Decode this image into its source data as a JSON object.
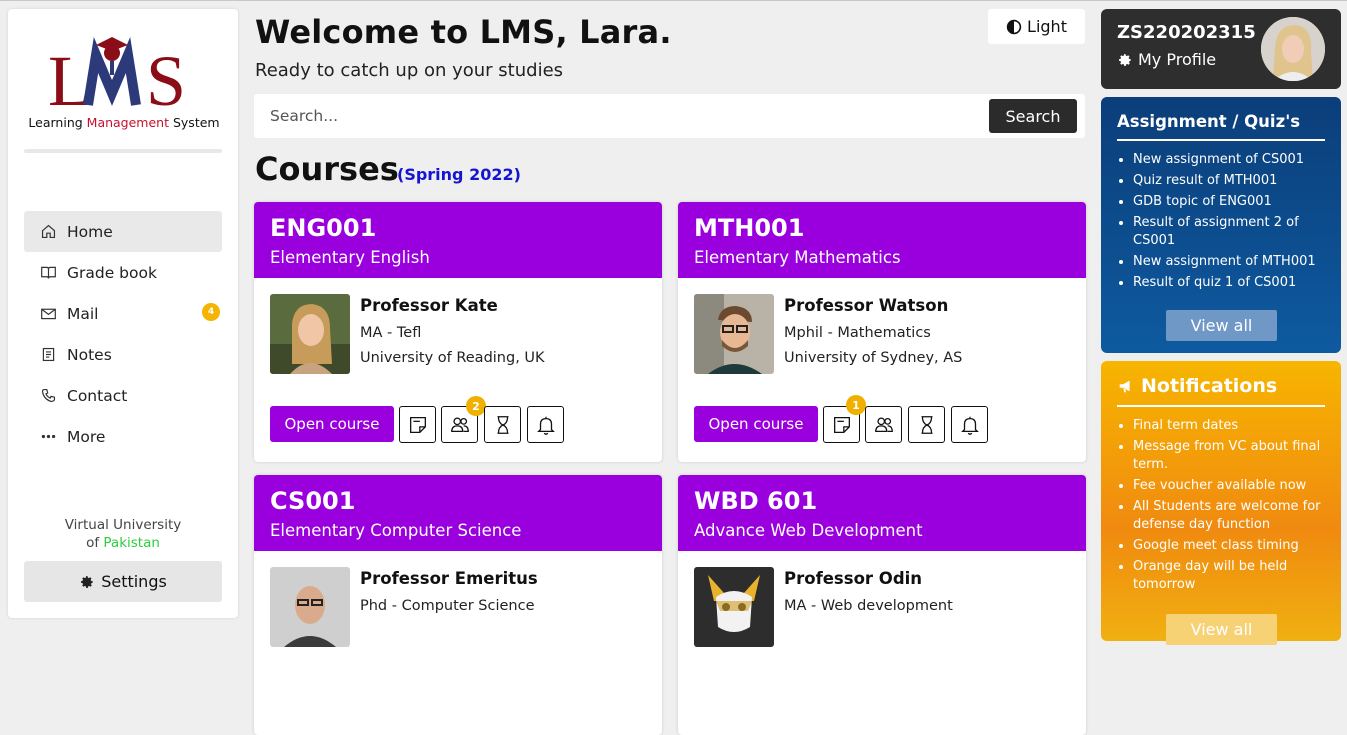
{
  "sidebar": {
    "logo_text_before": "Learning ",
    "logo_text_red": "Management",
    "logo_text_after": " System",
    "nav": [
      {
        "label": "Home",
        "icon": "home-icon"
      },
      {
        "label": "Grade book",
        "icon": "book-icon"
      },
      {
        "label": "Mail",
        "icon": "mail-icon",
        "badge": "4"
      },
      {
        "label": "Notes",
        "icon": "notes-icon"
      },
      {
        "label": "Contact",
        "icon": "phone-icon"
      },
      {
        "label": "More",
        "icon": "more-icon"
      }
    ],
    "university_line1": "Virtual University",
    "university_of": "of ",
    "university_country": "Pakistan",
    "settings_label": "Settings"
  },
  "header": {
    "welcome": "Welcome to LMS, Lara.",
    "subtitle": "Ready to catch up on your studies",
    "theme_label": "Light"
  },
  "search": {
    "placeholder": "Search...",
    "button_label": "Search"
  },
  "courses": {
    "title": "Courses",
    "semester": "(Spring 2022)",
    "open_label": "Open course",
    "items": [
      {
        "code": "ENG001",
        "name": "Elementary English",
        "professor": "Professor Kate",
        "degree": "MA - Tefl",
        "university": "University of Reading, UK",
        "group_badge": "2"
      },
      {
        "code": "MTH001",
        "name": "Elementary Mathematics",
        "professor": "Professor Watson",
        "degree": "Mphil - Mathematics",
        "university": "University of Sydney, AS",
        "notes_badge": "1"
      },
      {
        "code": "CS001",
        "name": "Elementary Computer Science",
        "professor": "Professor Emeritus",
        "degree": "Phd - Computer Science",
        "university": ""
      },
      {
        "code": "WBD 601",
        "name": "Advance Web Development",
        "professor": "Professor Odin",
        "degree": "MA - Web development",
        "university": ""
      }
    ]
  },
  "profile": {
    "id": "ZS220202315",
    "link_label": "My Profile"
  },
  "assignments": {
    "title": "Assignment / Quiz's",
    "items": [
      "New assignment of CS001",
      "Quiz result of MTH001",
      "GDB topic of ENG001",
      "Result of assignment 2 of CS001",
      "New assignment of MTH001",
      "Result of quiz 1 of CS001"
    ],
    "view_all": "View all"
  },
  "notifications": {
    "title": "Notifications",
    "items": [
      "Final term dates",
      "Message from VC about final term.",
      "Fee voucher available now",
      "All Students are welcome for defense day function",
      "Google meet class timing",
      "Orange day will be held tomorrow"
    ],
    "view_all": "View all"
  },
  "colors": {
    "course_purple": "#9900dd",
    "semester_blue": "#1515d0",
    "badge_yellow": "#f0b000",
    "assign_panel": "#0e5aa0",
    "notif_panel": "#f7b500"
  }
}
